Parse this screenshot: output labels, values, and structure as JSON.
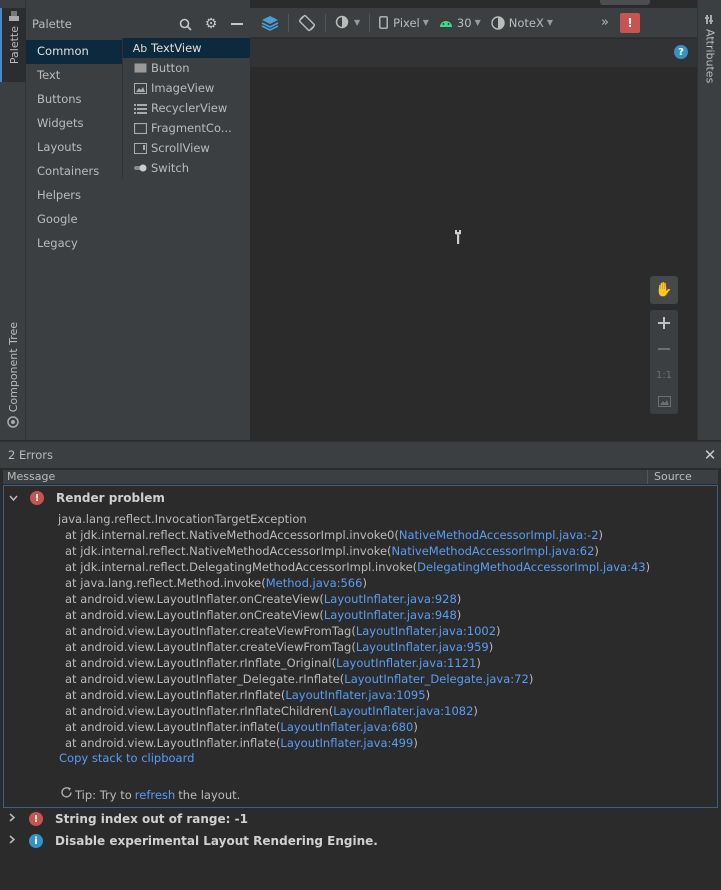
{
  "left_strip": {
    "palette_tab": "Palette",
    "component_tree_tab": "Component Tree"
  },
  "right_strip": {
    "attributes_tab": "Attributes"
  },
  "palette": {
    "title": "Palette",
    "categories": [
      "Common",
      "Text",
      "Buttons",
      "Widgets",
      "Layouts",
      "Containers",
      "Helpers",
      "Google",
      "Legacy"
    ],
    "widgets": [
      {
        "icon": "text-view-icon",
        "glyph": "Ab",
        "label": "TextView"
      },
      {
        "icon": "button-icon",
        "glyph": "",
        "label": "Button"
      },
      {
        "icon": "image-view-icon",
        "glyph": "",
        "label": "ImageView"
      },
      {
        "icon": "recycler-view-icon",
        "glyph": "",
        "label": "RecyclerView"
      },
      {
        "icon": "fragment-container-icon",
        "glyph": "",
        "label": "FragmentCo..."
      },
      {
        "icon": "scroll-view-icon",
        "glyph": "",
        "label": "ScrollView"
      },
      {
        "icon": "switch-icon",
        "glyph": "",
        "label": "Switch"
      }
    ]
  },
  "toolbar": {
    "device": "Pixel",
    "api": "30",
    "theme": "NoteX",
    "more": "»",
    "error_indicator": "!"
  },
  "canvas": {
    "help": "?",
    "zoom_reset": "1:1"
  },
  "errors": {
    "title": "2 Errors",
    "col_message": "Message",
    "col_source": "Source",
    "render_problem": {
      "title": "Render problem",
      "exception": "java.lang.reflect.InvocationTargetException",
      "stack": [
        {
          "text": "at jdk.internal.reflect.NativeMethodAccessorImpl.invoke0(",
          "link": "NativeMethodAccessorImpl.java:-2",
          "tail": ")"
        },
        {
          "text": "at jdk.internal.reflect.NativeMethodAccessorImpl.invoke(",
          "link": "NativeMethodAccessorImpl.java:62",
          "tail": ")"
        },
        {
          "text": "at jdk.internal.reflect.DelegatingMethodAccessorImpl.invoke(",
          "link": "DelegatingMethodAccessorImpl.java:43",
          "tail": ")"
        },
        {
          "text": "at java.lang.reflect.Method.invoke(",
          "link": "Method.java:566",
          "tail": ")"
        },
        {
          "text": "at android.view.LayoutInflater.onCreateView(",
          "link": "LayoutInflater.java:928",
          "tail": ")"
        },
        {
          "text": "at android.view.LayoutInflater.onCreateView(",
          "link": "LayoutInflater.java:948",
          "tail": ")"
        },
        {
          "text": "at android.view.LayoutInflater.createViewFromTag(",
          "link": "LayoutInflater.java:1002",
          "tail": ")"
        },
        {
          "text": "at android.view.LayoutInflater.createViewFromTag(",
          "link": "LayoutInflater.java:959",
          "tail": ")"
        },
        {
          "text": "at android.view.LayoutInflater.rInflate_Original(",
          "link": "LayoutInflater.java:1121",
          "tail": ")"
        },
        {
          "text": "at android.view.LayoutInflater_Delegate.rInflate(",
          "link": "LayoutInflater_Delegate.java:72",
          "tail": ")"
        },
        {
          "text": "at android.view.LayoutInflater.rInflate(",
          "link": "LayoutInflater.java:1095",
          "tail": ")"
        },
        {
          "text": "at android.view.LayoutInflater.rInflateChildren(",
          "link": "LayoutInflater.java:1082",
          "tail": ")"
        },
        {
          "text": "at android.view.LayoutInflater.inflate(",
          "link": "LayoutInflater.java:680",
          "tail": ")"
        },
        {
          "text": "at android.view.LayoutInflater.inflate(",
          "link": "LayoutInflater.java:499",
          "tail": ")"
        }
      ],
      "copy_stack": "Copy stack to clipboard",
      "tip_prefix": "Tip: Try to ",
      "tip_link": "refresh",
      "tip_suffix": " the layout."
    },
    "other": [
      {
        "type": "error",
        "badge": "!",
        "title": "String index out of range: -1"
      },
      {
        "type": "info",
        "badge": "i",
        "title": "Disable experimental Layout Rendering Engine."
      }
    ]
  }
}
